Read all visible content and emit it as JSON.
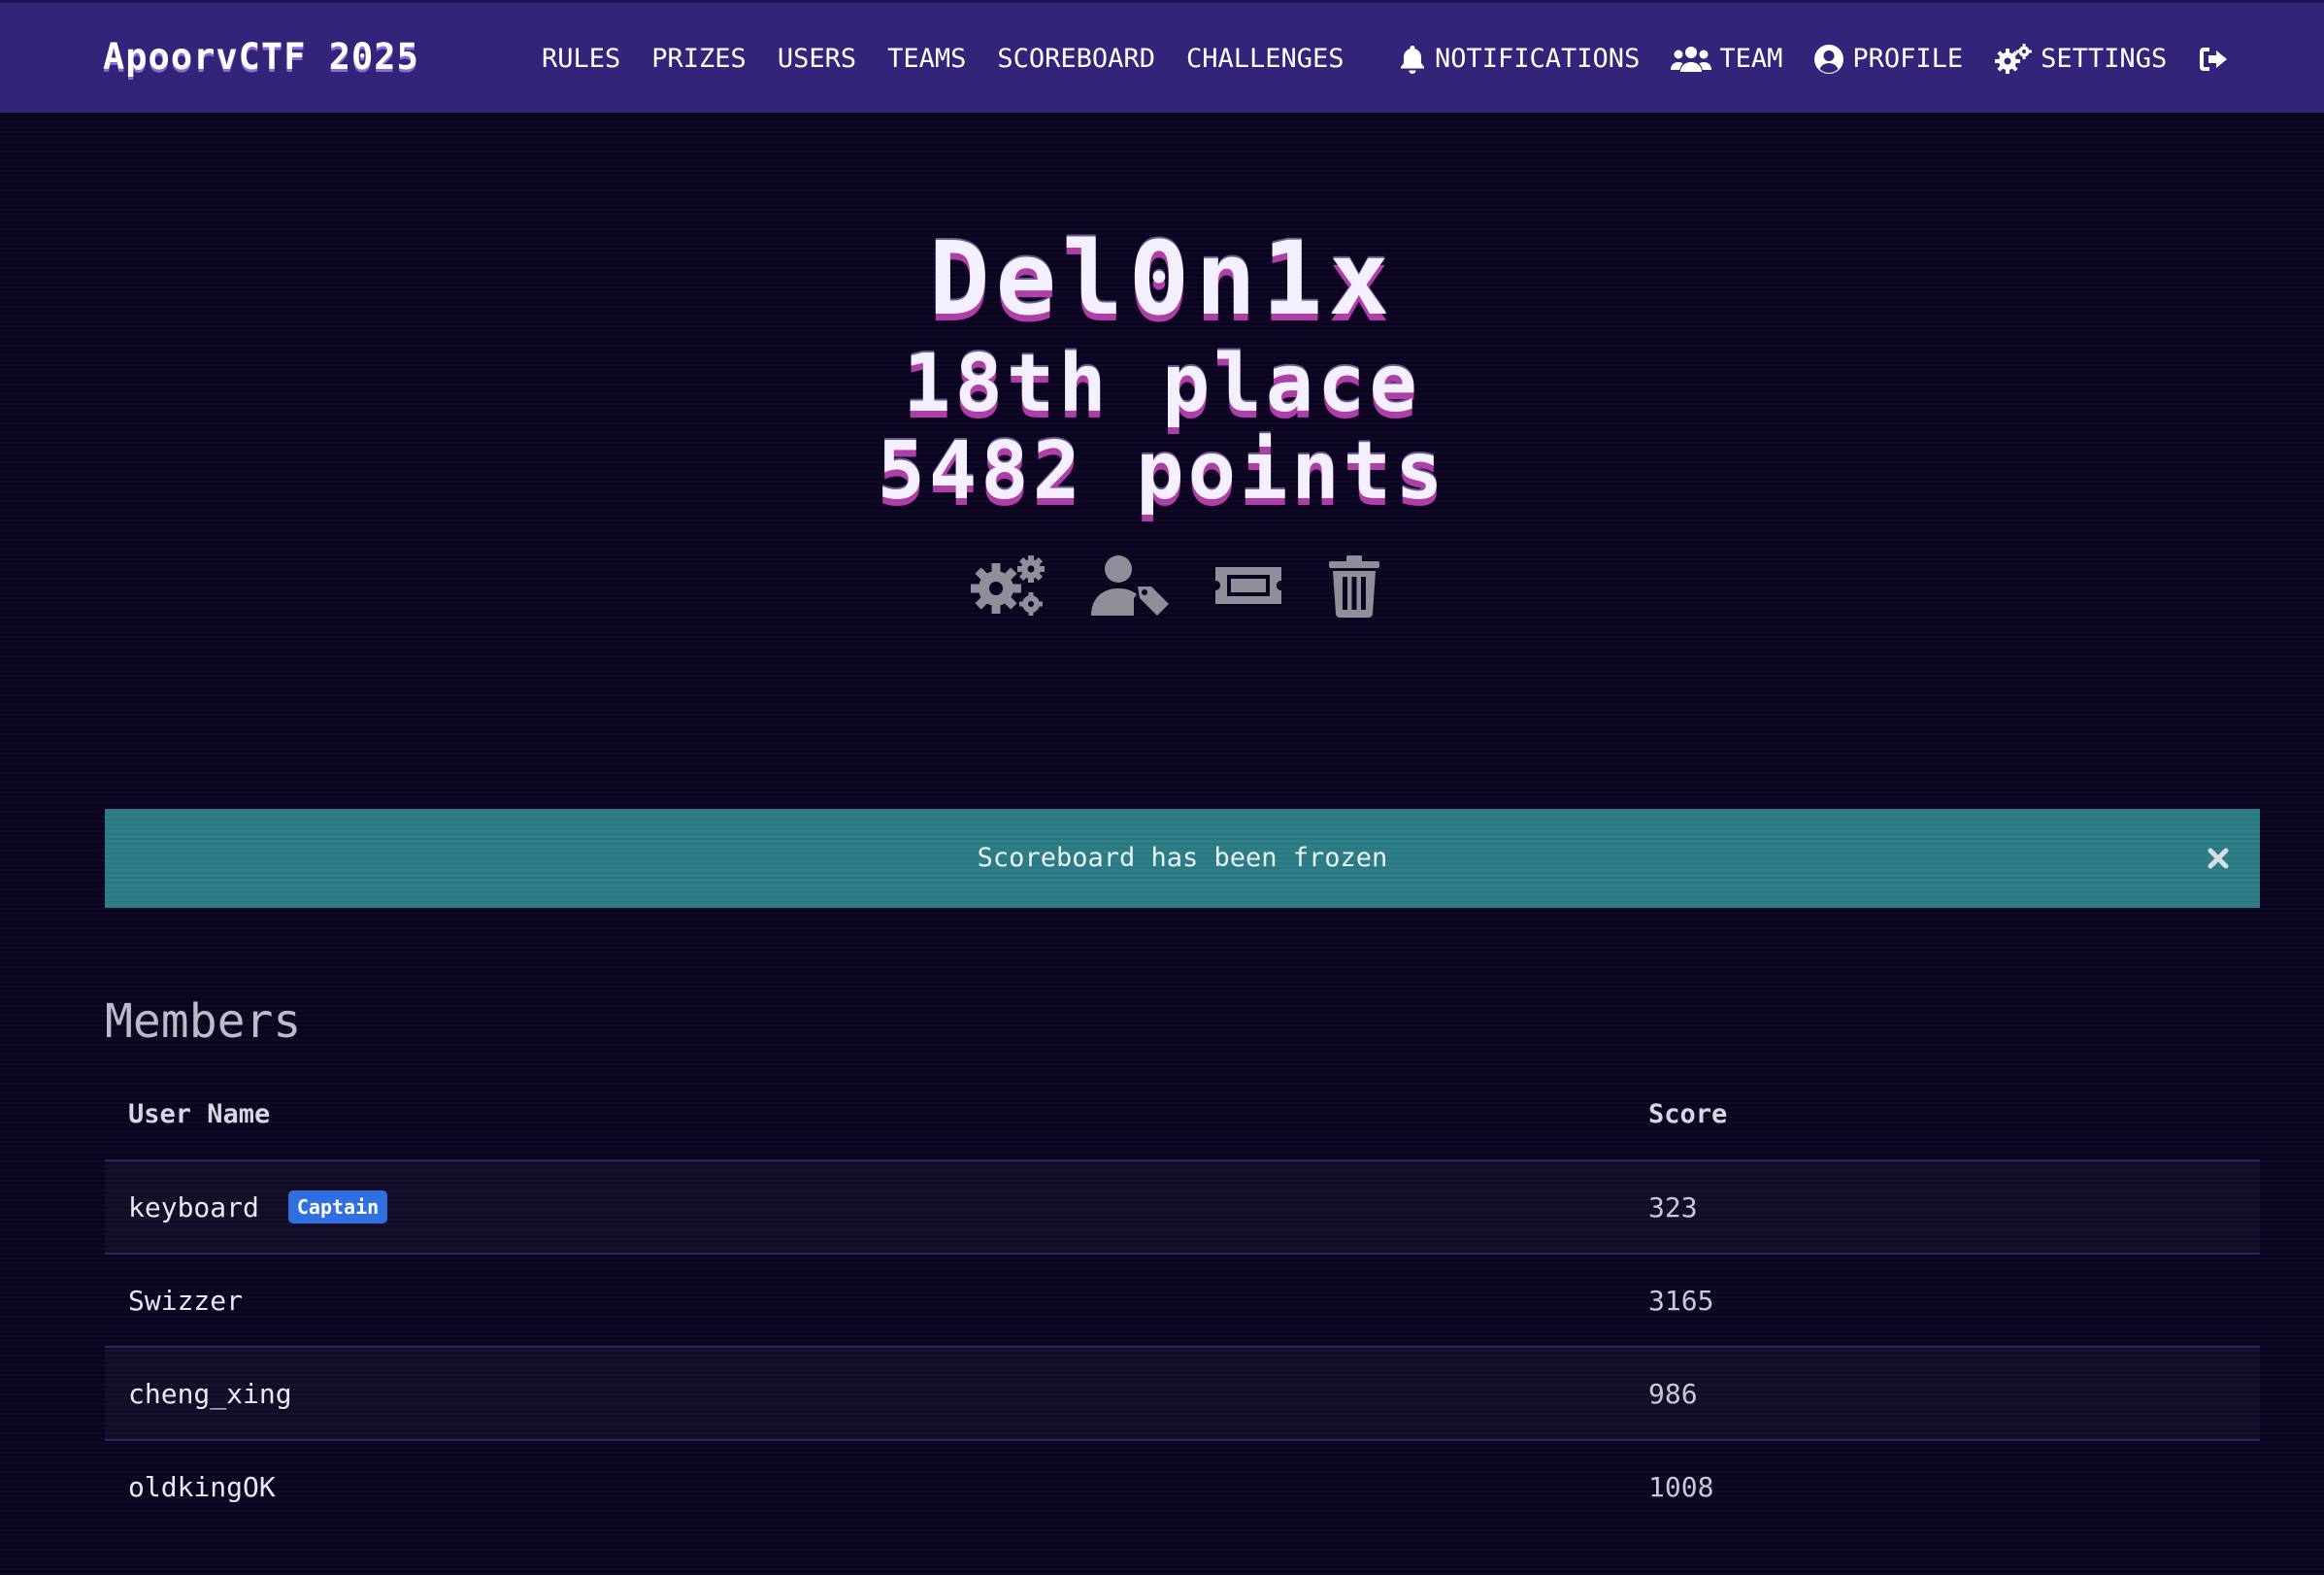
{
  "navbar": {
    "brand": "ApoorvCTF 2025",
    "links": [
      "RULES",
      "PRIZES",
      "USERS",
      "TEAMS",
      "SCOREBOARD",
      "CHALLENGES"
    ],
    "right": [
      {
        "label": "NOTIFICATIONS",
        "icon": "bell-icon"
      },
      {
        "label": "TEAM",
        "icon": "users-icon"
      },
      {
        "label": "PROFILE",
        "icon": "user-circle-icon"
      },
      {
        "label": "SETTINGS",
        "icon": "gears-icon"
      }
    ],
    "logout_icon": "sign-out-icon"
  },
  "team": {
    "name": "Del0n1x",
    "place": "18th place",
    "points": "5482 points",
    "actions": [
      "gears-icon",
      "user-tag-icon",
      "ticket-icon",
      "trash-icon"
    ]
  },
  "alert": {
    "message": "Scoreboard has been frozen",
    "close_icon": "close-icon"
  },
  "members": {
    "heading": "Members",
    "columns": [
      "User Name",
      "Score"
    ],
    "rows": [
      {
        "name": "keyboard",
        "badge": "Captain",
        "score": "323"
      },
      {
        "name": "Swizzer",
        "score": "3165"
      },
      {
        "name": "cheng_xing",
        "score": "986"
      },
      {
        "name": "oldkingOK",
        "score": "1008"
      }
    ]
  },
  "colors": {
    "navbar_bg": "#33247a",
    "page_bg": "#0b0420",
    "alert_bg": "#2f7f88",
    "badge_bg": "#2f6fe0",
    "title_shadow": "#b03ea8"
  }
}
